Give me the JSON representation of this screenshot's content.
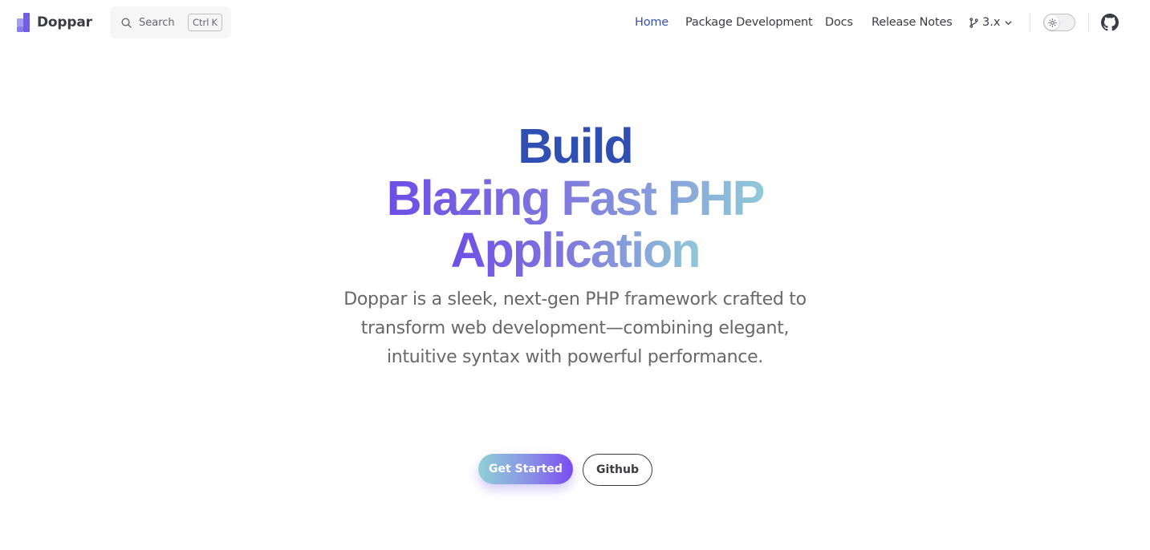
{
  "brand": {
    "name": "Doppar"
  },
  "search": {
    "label": "Search",
    "key_modifier": "Ctrl",
    "key_letter": "K"
  },
  "nav": {
    "items": [
      {
        "label": "Home",
        "active": true
      },
      {
        "label": "Package Development",
        "active": false
      },
      {
        "label": "Docs",
        "active": false
      },
      {
        "label": "Release Notes",
        "active": false
      }
    ],
    "version": "3.x",
    "version_icon": "git-branch-icon",
    "theme_icon": "sun-icon",
    "social_icon": "github-icon"
  },
  "hero": {
    "title_line_1": "Build",
    "title_line_2": "Blazing Fast PHP",
    "title_line_3": "Application",
    "tagline": "Doppar is a sleek, next-gen PHP framework crafted to transform web development—combining elegant, intuitive syntax with powerful performance."
  },
  "actions": {
    "primary_label": "Get Started",
    "secondary_label": "Github"
  },
  "colors": {
    "accent": "#3451b2",
    "title_solid": "#2f4fb3",
    "gradient_start": "#6d4ee6",
    "gradient_end": "#8fc9d8",
    "text": "#3c3c43",
    "muted_text": "#67676c"
  }
}
